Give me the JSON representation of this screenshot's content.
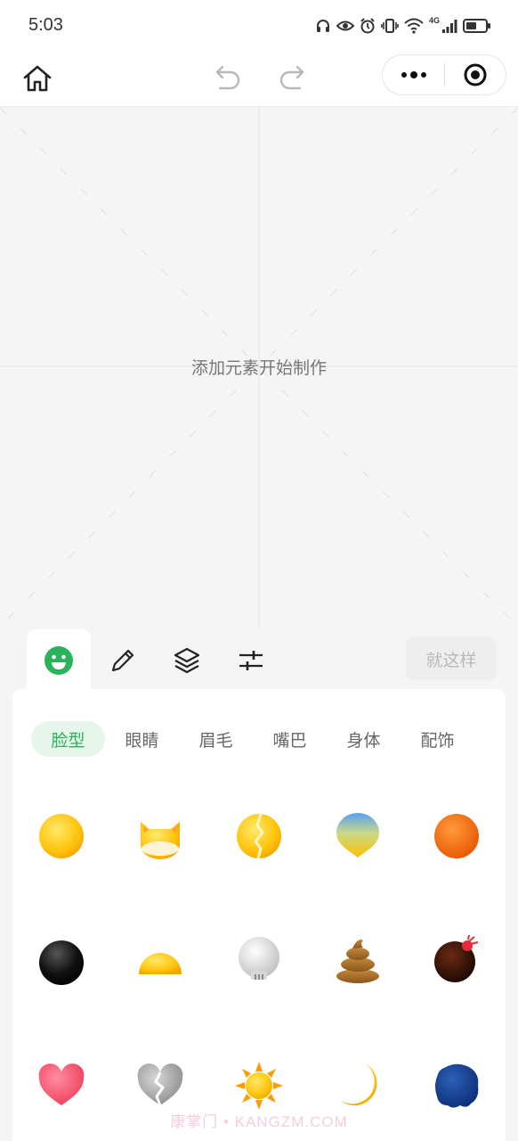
{
  "status_bar": {
    "time": "5:03",
    "network": "4G",
    "icons": [
      "headphones-icon",
      "eye-icon",
      "alarm-icon",
      "vibrate-icon",
      "wifi-icon",
      "signal-icon",
      "battery-icon"
    ]
  },
  "header": {
    "icons": [
      "home-icon",
      "undo-icon",
      "redo-icon",
      "more-icon",
      "close-target-icon"
    ]
  },
  "canvas": {
    "hint": "添加元素开始制作"
  },
  "tools": {
    "tabs": [
      "emoji-icon",
      "pencil-icon",
      "layers-icon",
      "sliders-icon"
    ],
    "done_label": "就这样"
  },
  "categories": [
    "脸型",
    "眼睛",
    "眉毛",
    "嘴巴",
    "身体",
    "配饰"
  ],
  "faces": [
    "yellow-face",
    "cat-face",
    "cracked-face",
    "gradient-drop-face",
    "orange-face",
    "black-face",
    "half-face",
    "skull-face",
    "poop-face",
    "bomb-face",
    "heart-face",
    "broken-heart-face",
    "sun-face",
    "moon-face",
    "blob-face"
  ],
  "colors": {
    "accent": "#2ab35a",
    "accent_bg": "#e6f6ea"
  },
  "watermark": "康掌门 • KANGZM.COM"
}
